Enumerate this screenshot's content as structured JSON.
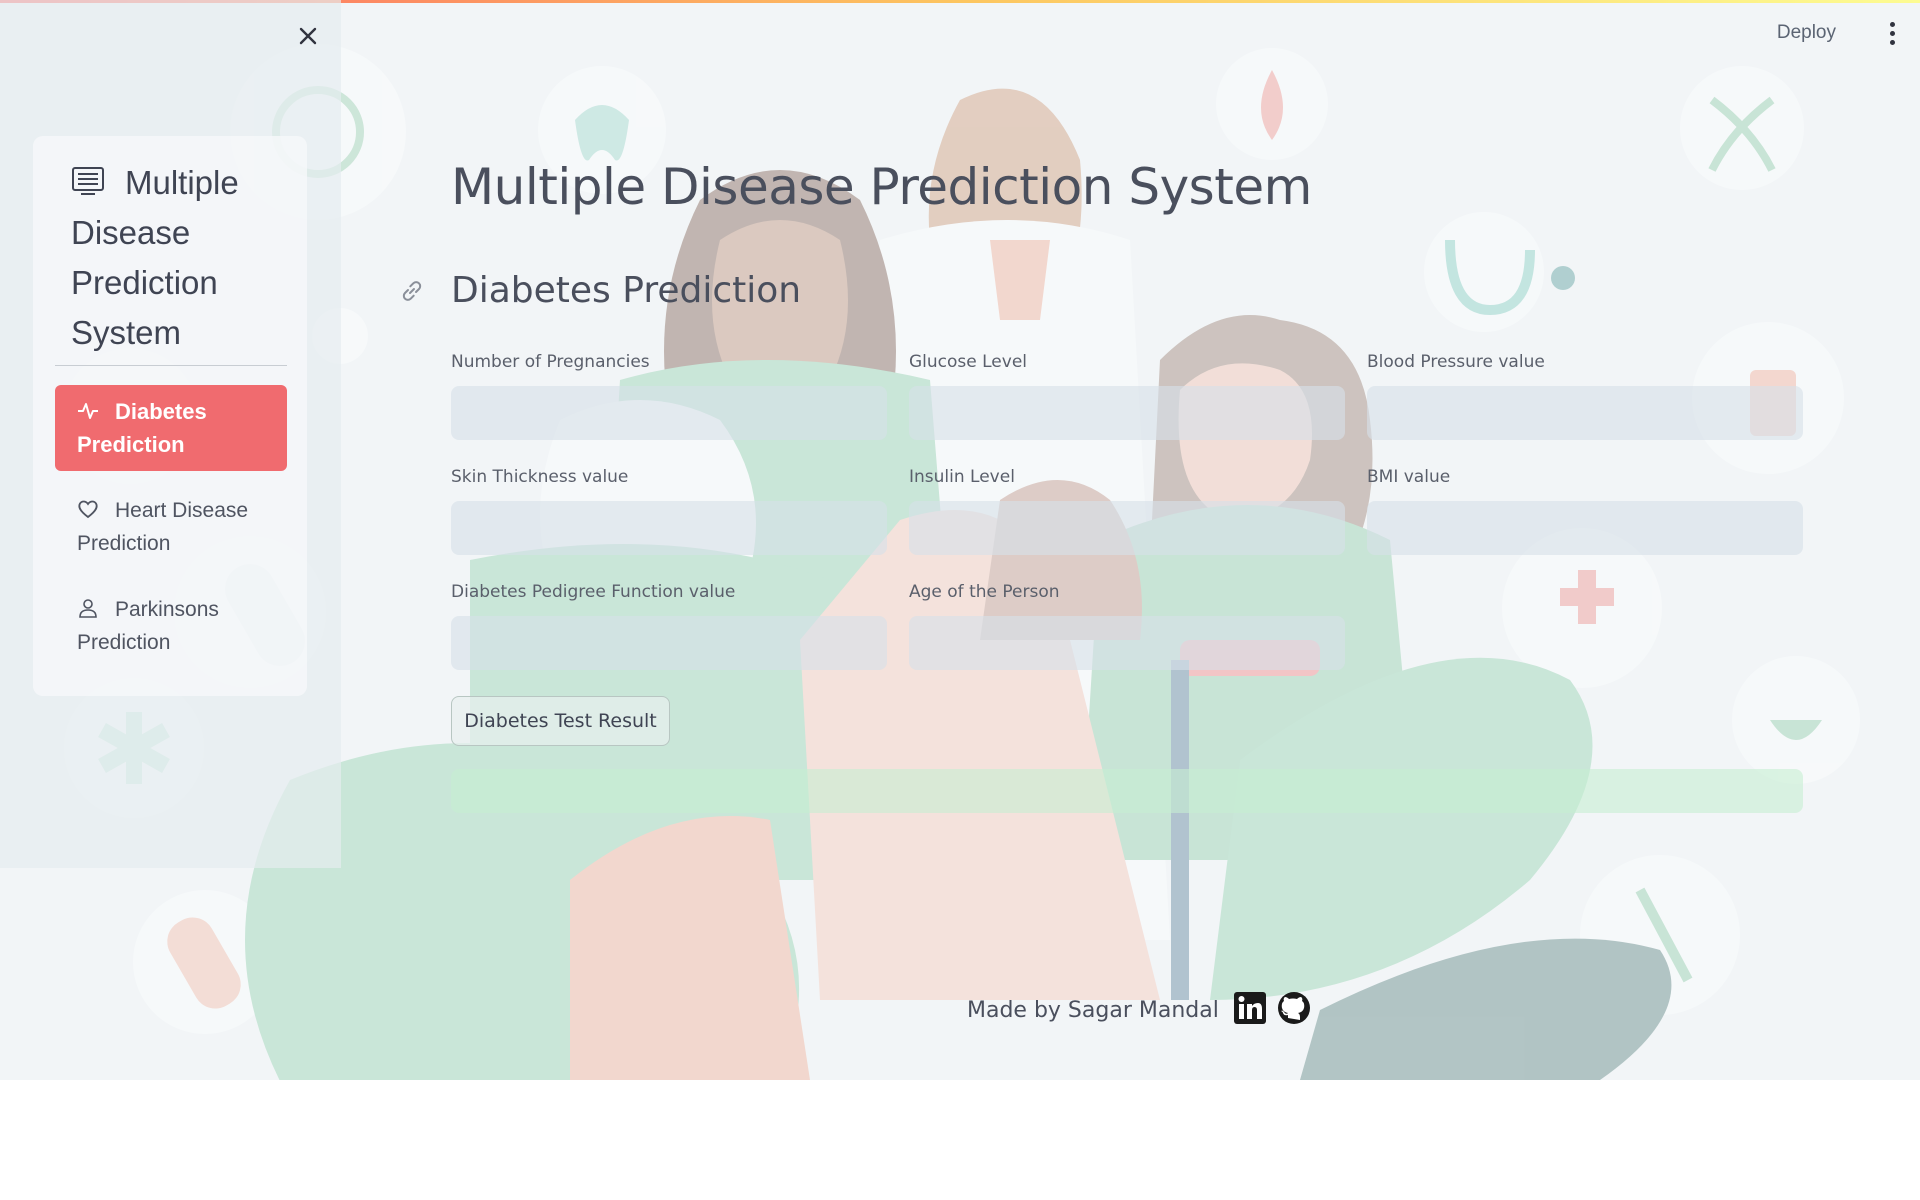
{
  "header": {
    "deploy_label": "Deploy",
    "menu_icon": "kebab-menu-icon"
  },
  "sidebar": {
    "close_icon": "close-icon",
    "menu_title": "Multiple Disease Prediction System",
    "menu_title_icon": "list-icon",
    "items": [
      {
        "label": "Diabetes Prediction",
        "icon": "activity-icon",
        "active": true
      },
      {
        "label": "Heart Disease Prediction",
        "icon": "heart-icon",
        "active": false
      },
      {
        "label": "Parkinsons Prediction",
        "icon": "person-icon",
        "active": false
      }
    ],
    "active_color": "#f06b6f"
  },
  "main": {
    "title": "Multiple Disease Prediction System",
    "section_title": "Diabetes Prediction",
    "fields": [
      {
        "label": "Number of Pregnancies",
        "value": ""
      },
      {
        "label": "Glucose Level",
        "value": ""
      },
      {
        "label": "Blood Pressure value",
        "value": ""
      },
      {
        "label": "Skin Thickness value",
        "value": ""
      },
      {
        "label": "Insulin Level",
        "value": ""
      },
      {
        "label": "BMI value",
        "value": ""
      },
      {
        "label": "Diabetes Pedigree Function value",
        "value": ""
      },
      {
        "label": "Age of the Person",
        "value": ""
      }
    ],
    "submit_label": "Diabetes Test Result",
    "result_text": ""
  },
  "footer": {
    "text": "Made by Sagar Mandal",
    "icons": [
      "linkedin-icon",
      "github-icon"
    ]
  }
}
